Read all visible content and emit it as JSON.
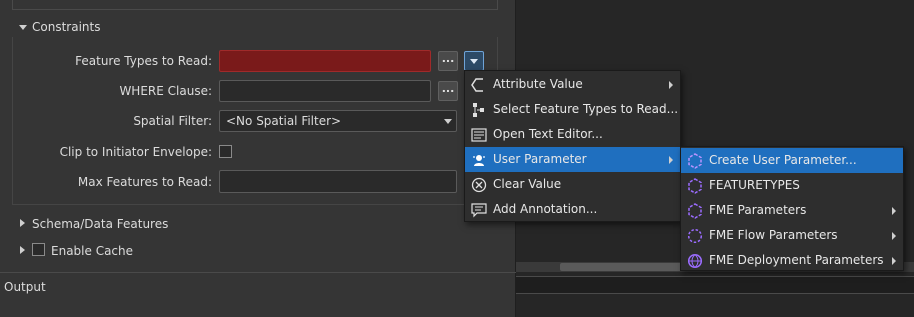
{
  "constraints": {
    "header": "Constraints",
    "feature_types_label": "Feature Types to Read:",
    "where_label": "WHERE Clause:",
    "spatial_filter_label": "Spatial Filter:",
    "spatial_filter_value": "<No Spatial Filter>",
    "clip_label": "Clip to Initiator Envelope:",
    "max_features_label": "Max Features to Read:",
    "ellipsis": "..."
  },
  "sections": {
    "schema": "Schema/Data Features",
    "enable_cache": "Enable Cache",
    "output": "Output"
  },
  "menu": {
    "items": [
      {
        "label": "Attribute Value",
        "icon": "attribute-value-icon",
        "submenu": true
      },
      {
        "label": "Select Feature Types to Read...",
        "icon": "select-feature-types-icon",
        "submenu": false
      },
      {
        "label": "Open Text Editor...",
        "icon": "text-editor-icon",
        "submenu": false
      },
      {
        "label": "User Parameter",
        "icon": "user-parameter-icon",
        "submenu": true
      },
      {
        "label": "Clear Value",
        "icon": "clear-value-icon",
        "submenu": false
      },
      {
        "label": "Add Annotation...",
        "icon": "annotation-icon",
        "submenu": false
      }
    ]
  },
  "submenu": {
    "items": [
      {
        "label": "Create User Parameter...",
        "icon": "create-parameter-icon",
        "submenu": false
      },
      {
        "label": "FEATURETYPES",
        "icon": "parameter-icon",
        "submenu": false
      },
      {
        "label": "FME Parameters",
        "icon": "parameter-icon",
        "submenu": true
      },
      {
        "label": "FME Flow Parameters",
        "icon": "flow-parameter-icon",
        "submenu": true
      },
      {
        "label": "FME Deployment Parameters",
        "icon": "deployment-parameter-icon",
        "submenu": true
      }
    ]
  },
  "colors": {
    "accent": "#1f6fbf",
    "invalid_field": "#7a1a1a",
    "parameter_icon": "#9b6cff"
  }
}
